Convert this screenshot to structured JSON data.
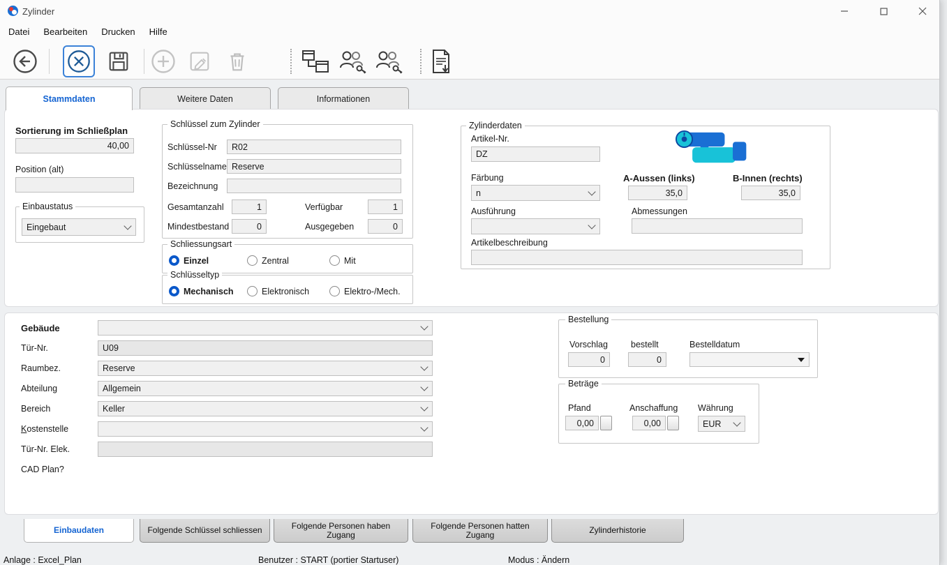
{
  "window": {
    "title": "Zylinder"
  },
  "menubar": {
    "items": [
      "Datei",
      "Bearbeiten",
      "Drucken",
      "Hilfe"
    ]
  },
  "toolbar": {
    "icons": [
      "back",
      "cancel",
      "save",
      "add",
      "edit",
      "delete",
      "lock-plan",
      "persons-have-access",
      "persons-had-access",
      "csv-export"
    ]
  },
  "tabs": {
    "items": [
      "Stammdaten",
      "Weitere Daten",
      "Informationen"
    ],
    "active": "Stammdaten"
  },
  "stammdaten": {
    "sortierung": {
      "label": "Sortierung im Schließplan",
      "value": "40,00"
    },
    "position_alt": {
      "label": "Position (alt)",
      "value": ""
    },
    "einbaustatus": {
      "legend": "Einbaustatus",
      "value": "Eingebaut"
    },
    "schluessel": {
      "legend": "Schlüssel zum Zylinder",
      "nr": {
        "label": "Schlüssel-Nr",
        "value": "R02"
      },
      "name": {
        "label": "Schlüsselname",
        "value": "Reserve"
      },
      "bezeichnung": {
        "label": "Bezeichnung",
        "value": ""
      },
      "gesamtanzahl": {
        "label": "Gesamtanzahl",
        "value": "1"
      },
      "verfuegbar": {
        "label": "Verfügbar",
        "value": "1"
      },
      "mindestbestand": {
        "label": "Mindestbestand",
        "value": "0"
      },
      "ausgegeben": {
        "label": "Ausgegeben",
        "value": "0"
      }
    },
    "schliessungsart": {
      "legend": "Schliessungsart",
      "options": [
        "Einzel",
        "Zentral",
        "Mit"
      ],
      "selected": "Einzel"
    },
    "schluesseltyp": {
      "legend": "Schlüsseltyp",
      "options": [
        "Mechanisch",
        "Elektronisch",
        "Elektro-/Mech."
      ],
      "selected": "Mechanisch"
    },
    "zylinderdaten": {
      "legend": "Zylinderdaten",
      "artikel_nr": {
        "label": "Artikel-Nr.",
        "value": "DZ"
      },
      "faerbung": {
        "label": "Färbung",
        "value": "n"
      },
      "a_aussen": {
        "label": "A-Aussen (links)",
        "value": "35,0"
      },
      "b_innen": {
        "label": "B-Innen (rechts)",
        "value": "35,0"
      },
      "ausfuehrung": {
        "label": "Ausführung",
        "value": ""
      },
      "abmessungen": {
        "label": "Abmessungen",
        "value": ""
      },
      "artikelbeschreibung": {
        "label": "Artikelbeschreibung",
        "value": ""
      }
    }
  },
  "einbaudaten": {
    "gebaeude": {
      "label": "Gebäude",
      "value": ""
    },
    "tuer_nr": {
      "label": "Tür-Nr.",
      "value": "U09"
    },
    "raumbez": {
      "label": "Raumbez.",
      "value": "Reserve"
    },
    "abteilung": {
      "label": "Abteilung",
      "value": "Allgemein"
    },
    "bereich": {
      "label": "Bereich",
      "value": "Keller"
    },
    "kostenstelle": {
      "label": "Kostenstelle",
      "value": ""
    },
    "tuer_nr_elek": {
      "label": "Tür-Nr. Elek.",
      "value": ""
    },
    "cad_plan": {
      "label": "CAD Plan?"
    },
    "bestellung": {
      "legend": "Bestellung",
      "vorschlag": {
        "label": "Vorschlag",
        "value": "0"
      },
      "bestellt": {
        "label": "bestellt",
        "value": "0"
      },
      "bestelldatum": {
        "label": "Bestelldatum",
        "value": ""
      }
    },
    "betraege": {
      "legend": "Beträge",
      "pfand": {
        "label": "Pfand",
        "value": "0,00"
      },
      "anschaffung": {
        "label": "Anschaffung",
        "value": "0,00"
      },
      "waehrung": {
        "label": "Währung",
        "value": "EUR"
      }
    }
  },
  "bottom_tabs": {
    "items": [
      "Einbaudaten",
      "Folgende Schlüssel schliessen",
      "Folgende Personen haben Zugang",
      "Folgende Personen hatten Zugang",
      "Zylinderhistorie"
    ],
    "active": "Einbaudaten"
  },
  "statusbar": {
    "anlage": "Anlage : Excel_Plan",
    "benutzer": "Benutzer : START (portier Startuser)",
    "modus": "Modus : Ändern"
  },
  "colors": {
    "accent": "#1464d2",
    "toolbar_highlight": "#3b82d8",
    "radio_selected": "#0a58ca"
  }
}
